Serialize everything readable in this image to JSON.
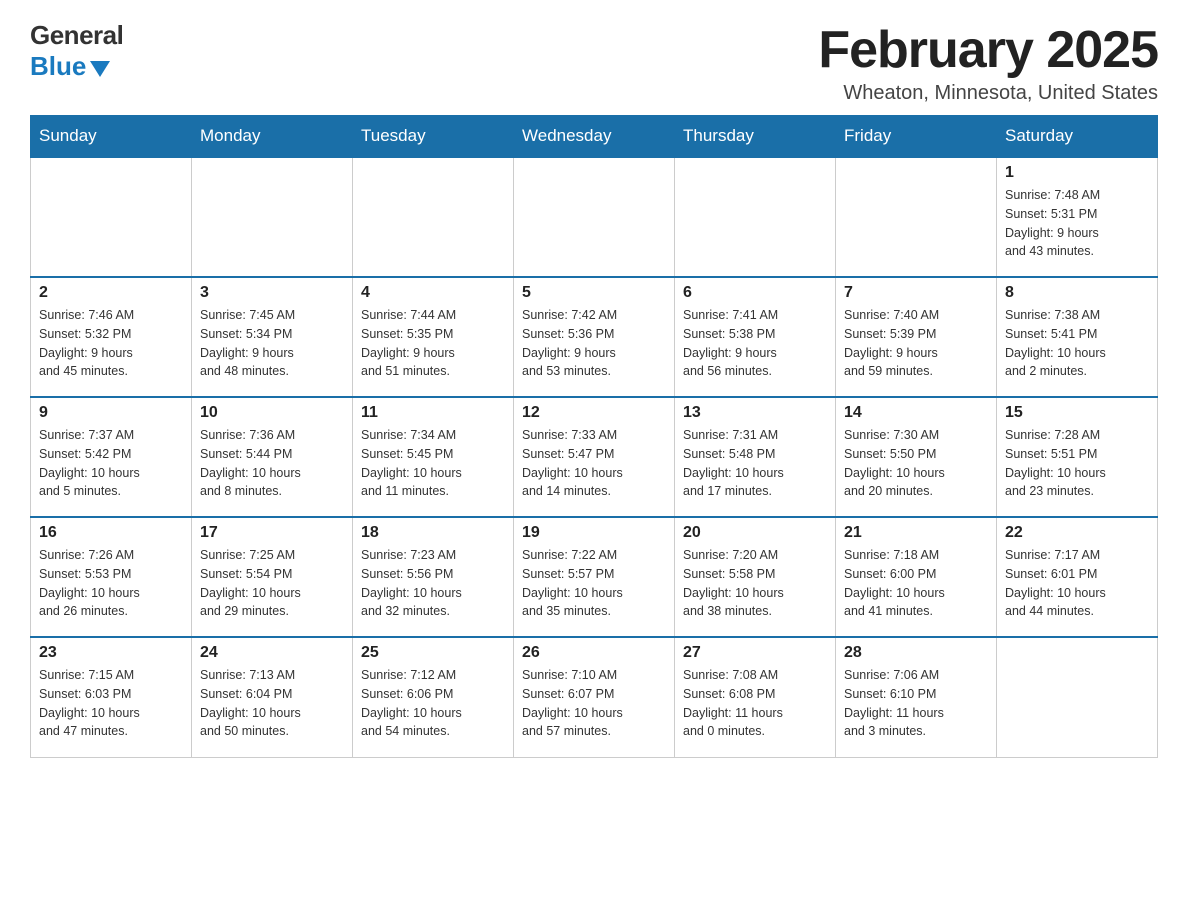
{
  "logo": {
    "general": "General",
    "blue": "Blue"
  },
  "title": "February 2025",
  "location": "Wheaton, Minnesota, United States",
  "days_of_week": [
    "Sunday",
    "Monday",
    "Tuesday",
    "Wednesday",
    "Thursday",
    "Friday",
    "Saturday"
  ],
  "weeks": [
    [
      {
        "day": "",
        "info": ""
      },
      {
        "day": "",
        "info": ""
      },
      {
        "day": "",
        "info": ""
      },
      {
        "day": "",
        "info": ""
      },
      {
        "day": "",
        "info": ""
      },
      {
        "day": "",
        "info": ""
      },
      {
        "day": "1",
        "info": "Sunrise: 7:48 AM\nSunset: 5:31 PM\nDaylight: 9 hours\nand 43 minutes."
      }
    ],
    [
      {
        "day": "2",
        "info": "Sunrise: 7:46 AM\nSunset: 5:32 PM\nDaylight: 9 hours\nand 45 minutes."
      },
      {
        "day": "3",
        "info": "Sunrise: 7:45 AM\nSunset: 5:34 PM\nDaylight: 9 hours\nand 48 minutes."
      },
      {
        "day": "4",
        "info": "Sunrise: 7:44 AM\nSunset: 5:35 PM\nDaylight: 9 hours\nand 51 minutes."
      },
      {
        "day": "5",
        "info": "Sunrise: 7:42 AM\nSunset: 5:36 PM\nDaylight: 9 hours\nand 53 minutes."
      },
      {
        "day": "6",
        "info": "Sunrise: 7:41 AM\nSunset: 5:38 PM\nDaylight: 9 hours\nand 56 minutes."
      },
      {
        "day": "7",
        "info": "Sunrise: 7:40 AM\nSunset: 5:39 PM\nDaylight: 9 hours\nand 59 minutes."
      },
      {
        "day": "8",
        "info": "Sunrise: 7:38 AM\nSunset: 5:41 PM\nDaylight: 10 hours\nand 2 minutes."
      }
    ],
    [
      {
        "day": "9",
        "info": "Sunrise: 7:37 AM\nSunset: 5:42 PM\nDaylight: 10 hours\nand 5 minutes."
      },
      {
        "day": "10",
        "info": "Sunrise: 7:36 AM\nSunset: 5:44 PM\nDaylight: 10 hours\nand 8 minutes."
      },
      {
        "day": "11",
        "info": "Sunrise: 7:34 AM\nSunset: 5:45 PM\nDaylight: 10 hours\nand 11 minutes."
      },
      {
        "day": "12",
        "info": "Sunrise: 7:33 AM\nSunset: 5:47 PM\nDaylight: 10 hours\nand 14 minutes."
      },
      {
        "day": "13",
        "info": "Sunrise: 7:31 AM\nSunset: 5:48 PM\nDaylight: 10 hours\nand 17 minutes."
      },
      {
        "day": "14",
        "info": "Sunrise: 7:30 AM\nSunset: 5:50 PM\nDaylight: 10 hours\nand 20 minutes."
      },
      {
        "day": "15",
        "info": "Sunrise: 7:28 AM\nSunset: 5:51 PM\nDaylight: 10 hours\nand 23 minutes."
      }
    ],
    [
      {
        "day": "16",
        "info": "Sunrise: 7:26 AM\nSunset: 5:53 PM\nDaylight: 10 hours\nand 26 minutes."
      },
      {
        "day": "17",
        "info": "Sunrise: 7:25 AM\nSunset: 5:54 PM\nDaylight: 10 hours\nand 29 minutes."
      },
      {
        "day": "18",
        "info": "Sunrise: 7:23 AM\nSunset: 5:56 PM\nDaylight: 10 hours\nand 32 minutes."
      },
      {
        "day": "19",
        "info": "Sunrise: 7:22 AM\nSunset: 5:57 PM\nDaylight: 10 hours\nand 35 minutes."
      },
      {
        "day": "20",
        "info": "Sunrise: 7:20 AM\nSunset: 5:58 PM\nDaylight: 10 hours\nand 38 minutes."
      },
      {
        "day": "21",
        "info": "Sunrise: 7:18 AM\nSunset: 6:00 PM\nDaylight: 10 hours\nand 41 minutes."
      },
      {
        "day": "22",
        "info": "Sunrise: 7:17 AM\nSunset: 6:01 PM\nDaylight: 10 hours\nand 44 minutes."
      }
    ],
    [
      {
        "day": "23",
        "info": "Sunrise: 7:15 AM\nSunset: 6:03 PM\nDaylight: 10 hours\nand 47 minutes."
      },
      {
        "day": "24",
        "info": "Sunrise: 7:13 AM\nSunset: 6:04 PM\nDaylight: 10 hours\nand 50 minutes."
      },
      {
        "day": "25",
        "info": "Sunrise: 7:12 AM\nSunset: 6:06 PM\nDaylight: 10 hours\nand 54 minutes."
      },
      {
        "day": "26",
        "info": "Sunrise: 7:10 AM\nSunset: 6:07 PM\nDaylight: 10 hours\nand 57 minutes."
      },
      {
        "day": "27",
        "info": "Sunrise: 7:08 AM\nSunset: 6:08 PM\nDaylight: 11 hours\nand 0 minutes."
      },
      {
        "day": "28",
        "info": "Sunrise: 7:06 AM\nSunset: 6:10 PM\nDaylight: 11 hours\nand 3 minutes."
      },
      {
        "day": "",
        "info": ""
      }
    ]
  ]
}
